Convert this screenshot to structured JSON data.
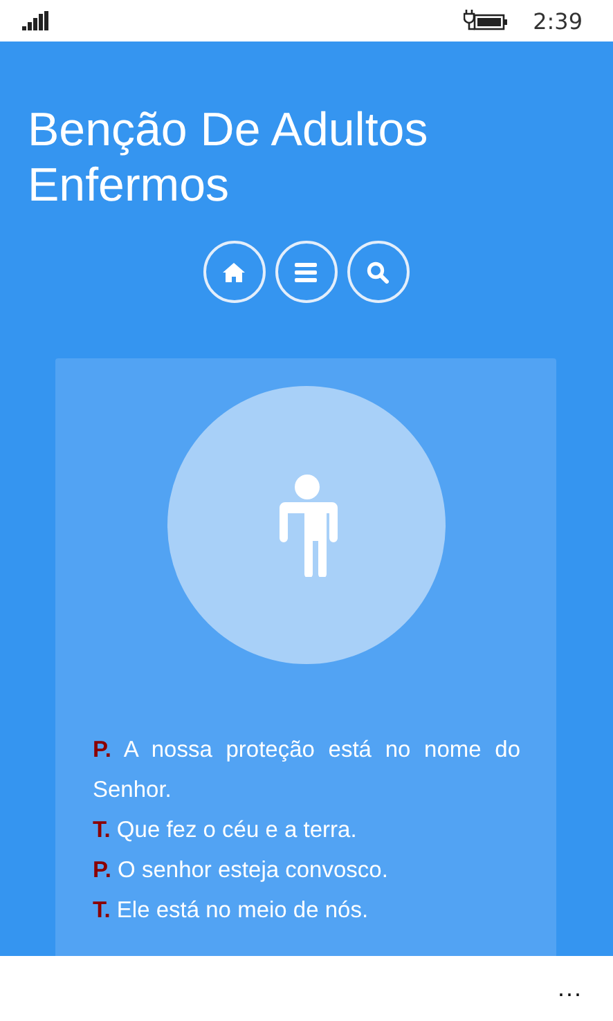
{
  "status_bar": {
    "time": "2:39"
  },
  "title": "Benção De Adultos Enfermos",
  "nav_buttons": [
    {
      "kind": "home"
    },
    {
      "kind": "menu"
    },
    {
      "kind": "search"
    }
  ],
  "card": {
    "picture": {
      "kind": "person"
    },
    "lines": [
      {
        "speaker": "P.",
        "text": "A nossa proteção está no nome do Senhor."
      },
      {
        "speaker": "T.",
        "text": "Que fez o céu e a terra."
      },
      {
        "speaker": "P.",
        "text": "O senhor esteja convosco."
      },
      {
        "speaker": "T.",
        "text": "Ele está no meio de nós."
      }
    ]
  },
  "app_bar": {
    "more": "..."
  }
}
